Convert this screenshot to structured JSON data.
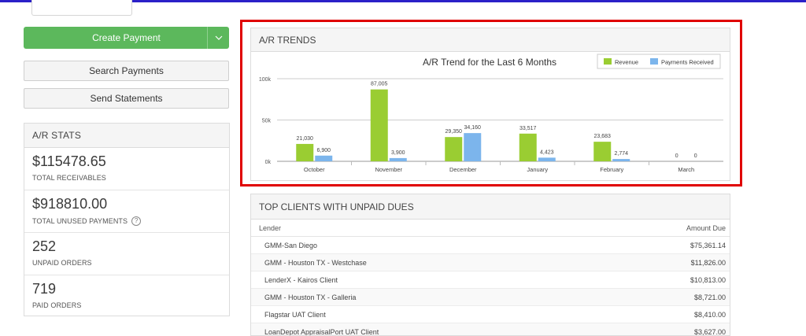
{
  "left": {
    "create_payment": "Create Payment",
    "search_payments": "Search Payments",
    "send_statements": "Send Statements"
  },
  "stats": {
    "title": "A/R STATS",
    "items": [
      {
        "value": "$115478.65",
        "label": "TOTAL RECEIVABLES"
      },
      {
        "value": "$918810.00",
        "label": "TOTAL UNUSED PAYMENTS"
      },
      {
        "value": "252",
        "label": "UNPAID ORDERS"
      },
      {
        "value": "719",
        "label": "PAID ORDERS"
      }
    ]
  },
  "trends": {
    "title": "A/R TRENDS"
  },
  "chart_data": {
    "type": "bar",
    "title": "A/R Trend for the Last 6 Months",
    "categories": [
      "October",
      "November",
      "December",
      "January",
      "February",
      "March"
    ],
    "series": [
      {
        "name": "Revenue",
        "color": "#9acd32",
        "values": [
          21030,
          87005,
          29350,
          33517,
          23683,
          0
        ],
        "labels": [
          "21,030",
          "87,005",
          "29,350",
          "33,517",
          "23,683",
          "0"
        ]
      },
      {
        "name": "Payments Received",
        "color": "#7cb5ec",
        "values": [
          6900,
          3900,
          34160,
          4423,
          2774,
          0
        ],
        "labels": [
          "6,900",
          "3,900",
          "34,160",
          "4,423",
          "2,774",
          "0"
        ]
      }
    ],
    "ylim": [
      0,
      100000
    ],
    "yticks": [
      0,
      50000,
      100000
    ],
    "ytick_labels": [
      "0k",
      "50k",
      "100k"
    ],
    "legend": "top-right",
    "grid": true
  },
  "clients": {
    "title": "TOP CLIENTS WITH UNPAID DUES",
    "col_lender": "Lender",
    "col_amount": "Amount Due",
    "rows": [
      {
        "lender": "GMM-San Diego",
        "amount": "$75,361.14"
      },
      {
        "lender": "GMM - Houston TX - Westchase",
        "amount": "$11,826.00"
      },
      {
        "lender": "LenderX - Kairos Client",
        "amount": "$10,813.00"
      },
      {
        "lender": "GMM - Houston TX - Galleria",
        "amount": "$8,721.00"
      },
      {
        "lender": "Flagstar UAT Client",
        "amount": "$8,410.00"
      },
      {
        "lender": "LoanDepot AppraisalPort UAT Client",
        "amount": "$3,627.00"
      }
    ]
  }
}
